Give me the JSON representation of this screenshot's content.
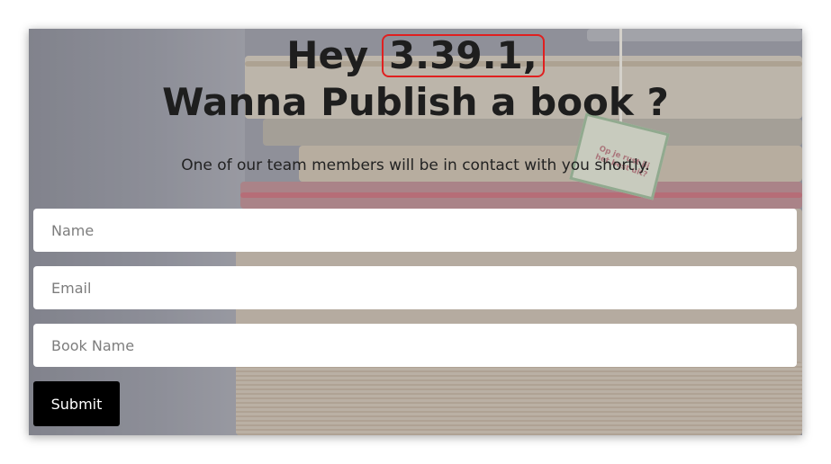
{
  "heading": {
    "greeting": "Hey",
    "version": "3.39.1,",
    "line2": "Wanna Publish a book ?"
  },
  "subtitle": "One of our team members will be in contact with you shortly.",
  "form": {
    "name_placeholder": "Name",
    "email_placeholder": "Email",
    "book_placeholder": "Book Name",
    "submit_label": "Submit"
  },
  "background": {
    "tag_text": "Op je rust jij het best uit?"
  },
  "colors": {
    "highlight": "#e02020",
    "button": "#000000"
  }
}
